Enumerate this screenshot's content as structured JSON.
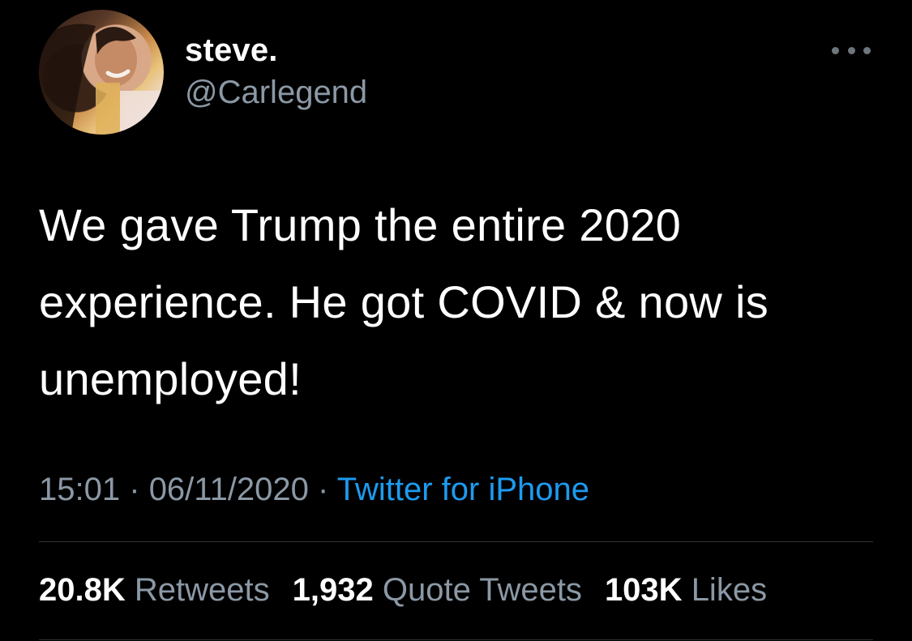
{
  "user": {
    "display_name": "steve.",
    "handle": "@Carlegend"
  },
  "tweet": {
    "text": "We gave Trump the entire 2020 experience. He got COVID & now is unemployed!",
    "time": "15:01",
    "date": "06/11/2020",
    "separator": "·",
    "source": "Twitter for iPhone"
  },
  "stats": {
    "retweets_count": "20.8K",
    "retweets_label": "Retweets",
    "quotes_count": "1,932",
    "quotes_label": "Quote Tweets",
    "likes_count": "103K",
    "likes_label": "Likes"
  },
  "colors": {
    "background": "#000000",
    "text": "#ffffff",
    "secondary_text": "#8b98a5",
    "link": "#1d9bf0",
    "divider": "#2f3336"
  },
  "icons": {
    "more": "more-horizontal-icon"
  }
}
